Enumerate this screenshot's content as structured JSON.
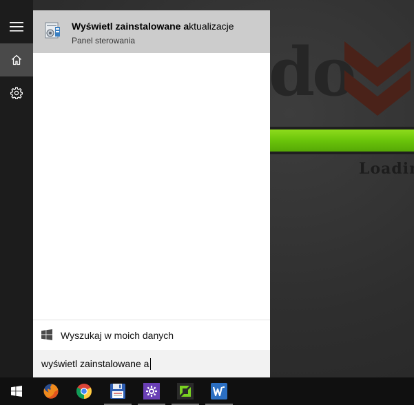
{
  "desktop": {
    "wallpaper_text": "do",
    "wallpaper_loading": "Loadin",
    "accent_green": "#6ac40a",
    "logo_color": "#5a2a1e"
  },
  "rail": {
    "items": [
      {
        "icon": "hamburger-icon"
      },
      {
        "icon": "home-icon",
        "selected": true
      },
      {
        "icon": "gear-icon"
      }
    ]
  },
  "results": {
    "best_match": {
      "title_bold": "Wyświetl zainstalowane a",
      "title_rest": "ktualizacje",
      "subtitle": "Panel sterowania",
      "icon": "control-panel-icon"
    }
  },
  "search_mine": {
    "label": "Wyszukaj w moich danych",
    "icon": "windows-icon"
  },
  "search": {
    "query": "wyświetl zainstalowane a"
  },
  "taskbar": {
    "start_icon": "windows-start-icon",
    "apps": [
      {
        "name": "firefox-icon",
        "running": false
      },
      {
        "name": "chrome-icon",
        "running": false
      },
      {
        "name": "floppy-save-icon",
        "running": true
      },
      {
        "name": "purple-gear-app-icon",
        "running": true
      },
      {
        "name": "green-logo-app-icon",
        "running": true
      },
      {
        "name": "wps-writer-icon",
        "running": true
      }
    ]
  }
}
